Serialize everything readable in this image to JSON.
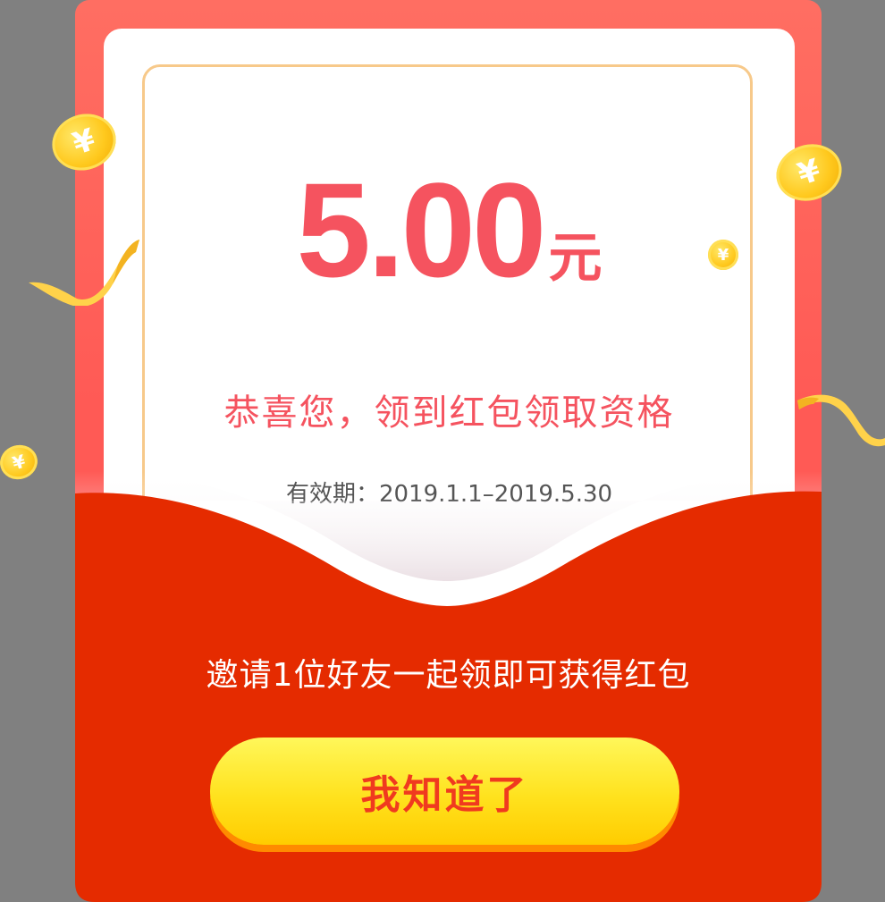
{
  "amount": {
    "value": "5.00",
    "unit": "元"
  },
  "message": {
    "congrats": "恭喜您，领到红包领取资格",
    "validity": "有效期：2019.1.1–2019.5.30"
  },
  "invite": {
    "text": "邀请1位好友一起领即可获得红包"
  },
  "button": {
    "label": "我知道了"
  },
  "decor": {
    "coin_symbol": "¥"
  },
  "colors": {
    "packet_red": "#ff5a55",
    "flap_red": "#e52b00",
    "amount_red": "#f5535f",
    "button_yellow": "#ffe21e",
    "button_text": "#f03a1f",
    "frame_gold": "#f7c98a"
  }
}
